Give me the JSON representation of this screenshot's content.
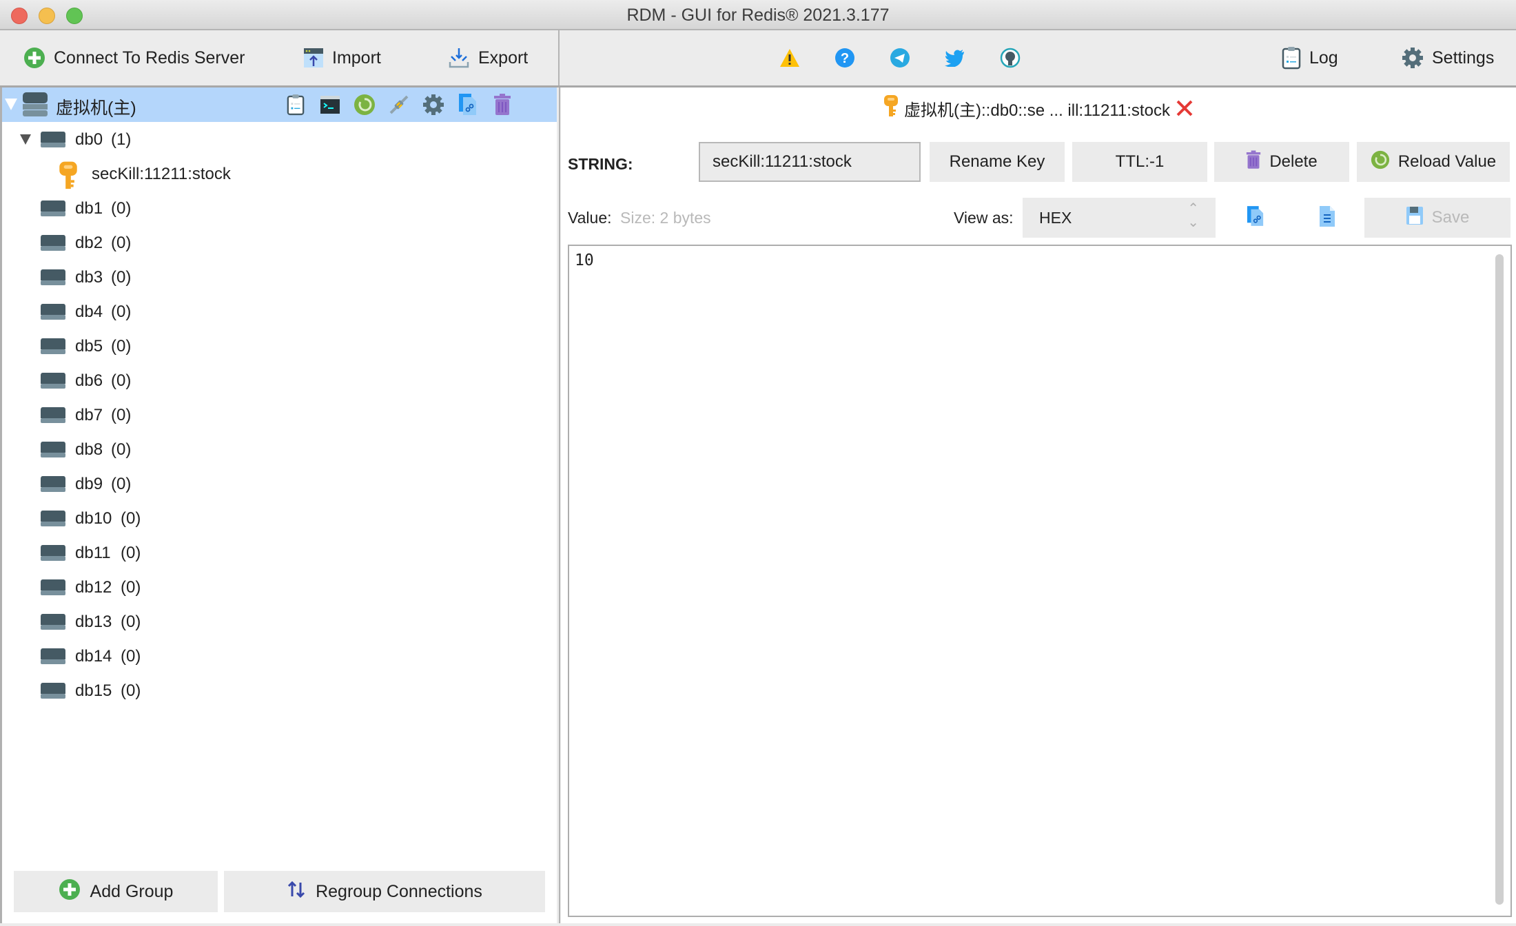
{
  "window": {
    "title": "RDM - GUI for Redis® 2021.3.177"
  },
  "toolbar": {
    "connect_label": "Connect To Redis Server",
    "import_label": "Import",
    "export_label": "Export",
    "center_icons": [
      "warning-icon",
      "help-icon",
      "telegram-icon",
      "twitter-icon",
      "github-icon"
    ],
    "log_label": "Log",
    "settings_label": "Settings"
  },
  "tree": {
    "connection": {
      "name": "虚拟机(主)",
      "actions": [
        "server-info-icon",
        "console-icon",
        "reload-icon",
        "disconnect-icon",
        "settings-icon",
        "duplicate-icon",
        "delete-icon"
      ]
    },
    "databases": [
      {
        "name": "db0",
        "count": "(1)",
        "expanded": true,
        "keys": [
          "secKill:11211:stock"
        ]
      },
      {
        "name": "db1",
        "count": "(0)"
      },
      {
        "name": "db2",
        "count": "(0)"
      },
      {
        "name": "db3",
        "count": "(0)"
      },
      {
        "name": "db4",
        "count": "(0)"
      },
      {
        "name": "db5",
        "count": "(0)"
      },
      {
        "name": "db6",
        "count": "(0)"
      },
      {
        "name": "db7",
        "count": "(0)"
      },
      {
        "name": "db8",
        "count": "(0)"
      },
      {
        "name": "db9",
        "count": "(0)"
      },
      {
        "name": "db10",
        "count": "(0)"
      },
      {
        "name": "db11",
        "count": "(0)"
      },
      {
        "name": "db12",
        "count": "(0)"
      },
      {
        "name": "db13",
        "count": "(0)"
      },
      {
        "name": "db14",
        "count": "(0)"
      },
      {
        "name": "db15",
        "count": "(0)"
      }
    ]
  },
  "left_footer": {
    "add_group_label": "Add Group",
    "regroup_label": "Regroup Connections"
  },
  "key_tab": {
    "title": "虚拟机(主)::db0::se ... ill:11211:stock"
  },
  "key_view": {
    "type_label": "STRING:",
    "key_name": "secKill:11211:stock",
    "rename_label": "Rename Key",
    "ttl_label": "TTL:-1",
    "delete_label": "Delete",
    "reload_label": "Reload Value",
    "value_label": "Value:",
    "size_label": "Size: 2 bytes",
    "view_as_label": "View as:",
    "view_as_value": "HEX",
    "save_label": "Save",
    "value_text": "10"
  },
  "colors": {
    "selection": "#b4d6fb",
    "green": "#4caf50",
    "purple": "#8e6bc9",
    "key_orange": "#f5a623",
    "close_red": "#e53935"
  }
}
